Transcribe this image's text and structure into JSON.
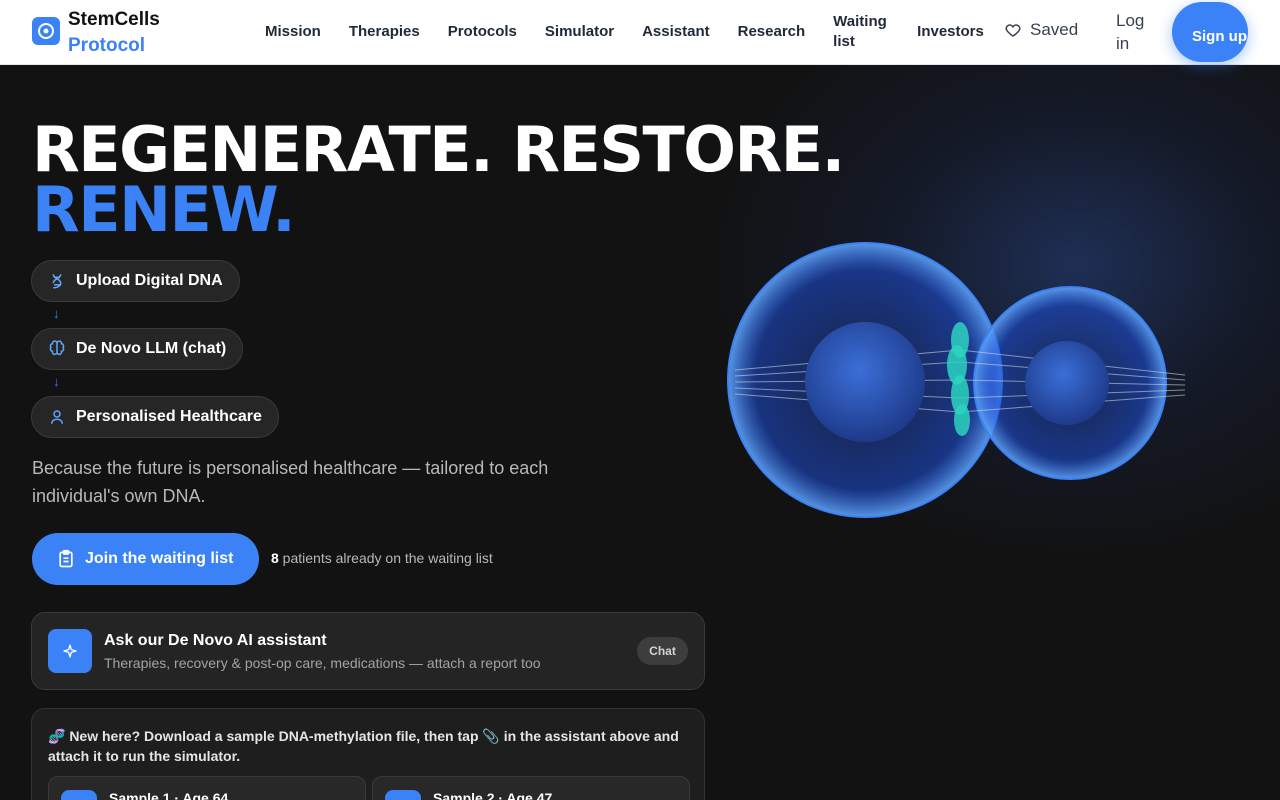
{
  "header": {
    "brand_name": "StemCells",
    "brand_sub": "Protocol",
    "nav": [
      "Mission",
      "Therapies",
      "Protocols",
      "Simulator",
      "Assistant",
      "Research",
      "Waiting list",
      "Investors"
    ],
    "saved": "Saved",
    "login": "Log in",
    "signup": "Sign up"
  },
  "hero": {
    "title_line1": "REGENERATE. RESTORE.",
    "title_line2": "RENEW.",
    "steps": [
      {
        "label": "Upload Digital DNA",
        "icon": "dna-icon"
      },
      {
        "label": "De Novo LLM (chat)",
        "icon": "brain-icon"
      },
      {
        "label": "Personalised Healthcare",
        "icon": "user-icon"
      }
    ],
    "tagline": "Because the future is personalised healthcare — tailored to each individual's own DNA.",
    "join_button": "Join the waiting list",
    "waiting_count": "8",
    "waiting_text": " patients already on the waiting list"
  },
  "assistant": {
    "title": "Ask our De Novo AI assistant",
    "subtitle": "Therapies, recovery & post-op care, medications — attach a report too",
    "chat_button": "Chat"
  },
  "samples": {
    "intro": "🧬 New here? Download a sample DNA-methylation file, then tap 📎 in the assistant above and attach it to run the simulator.",
    "items": [
      "Sample 1 · Age 64",
      "Sample 2 · Age 47"
    ]
  },
  "colors": {
    "accent": "#3b82f6",
    "background": "#121212",
    "card": "#242424"
  }
}
